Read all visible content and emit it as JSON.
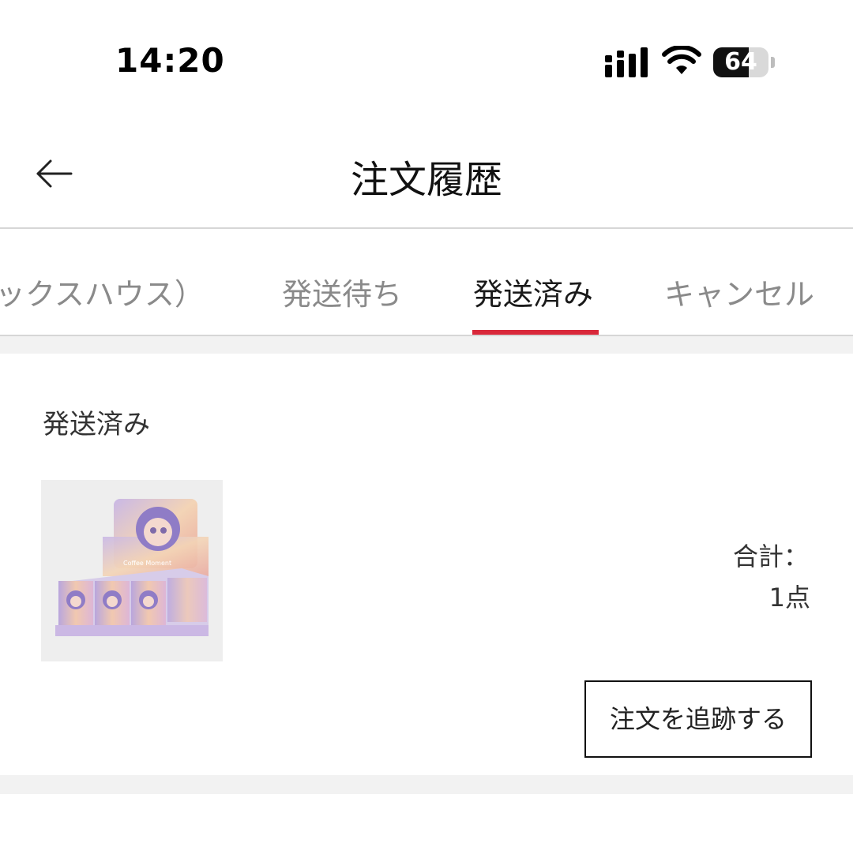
{
  "status_bar": {
    "time": "14:20",
    "battery_level": "64",
    "icons": [
      "signal-icon",
      "wifi-icon",
      "battery-icon"
    ]
  },
  "header": {
    "title": "注文履歴",
    "back_icon": "arrow-left-icon"
  },
  "tabs": [
    {
      "label": "ックスハウス）",
      "active": false
    },
    {
      "label": "発送待ち",
      "active": false
    },
    {
      "label": "発送済み",
      "active": true
    },
    {
      "label": "キャンセル",
      "active": false
    }
  ],
  "order": {
    "status": "発送済み",
    "product_image_text": "Coffee Moment",
    "total_label": "合計：",
    "total_quantity": "1点",
    "track_button_label": "注文を追跡する"
  },
  "colors": {
    "accent": "#d9283a",
    "divider": "#d6d6d6",
    "gap_background": "#f2f2f2"
  }
}
